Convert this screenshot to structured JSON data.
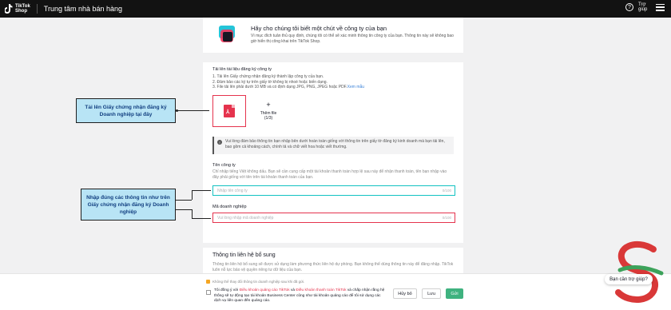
{
  "header": {
    "logo_line1": "TikTok",
    "logo_line2": "Shop",
    "title": "Trung tâm nhà bán hàng",
    "help_label": "Trợ giúp",
    "help_icon": "question-circle-icon",
    "menu_icon": "hamburger-menu-icon"
  },
  "intro": {
    "title": "Hãy cho chúng tôi biết một chút về công ty của bạn",
    "description": "Vì mục đích tuân thủ quy định, chúng tôi có thể sẽ xác minh thông tin công ty của bạn. Thông tin này sẽ không bao giờ hiển thị công khai trên TikTok Shop."
  },
  "upload_section": {
    "title": "Tải lên tài liệu đăng ký công ty",
    "step1": "1. Tải lên Giấy chứng nhận đăng ký thành lập công ty của bạn.",
    "step2": "2. Đảm bảo các ký tự trên giấy tờ không bị nhoè hoặc biến dạng.",
    "step3": "3. File tải lên phải dưới 10 MB và có định dạng JPG, PNG, JPEG hoặc PDF.",
    "example_link": "Xem mẫu",
    "add_file_label": "Thêm file",
    "add_file_count": "(1/3)"
  },
  "notice": "Vui lòng đảm bảo thông tin bạn nhập bên dưới hoàn toàn giống với thông tin trên giấy tờ đăng ký kinh doanh mà bạn tải lên, bao gồm cả khoảng cách, chính tả và chữ viết hoa hoặc viết thường.",
  "company_name": {
    "title": "Tên công ty",
    "help": "Chỉ nhập tiếng Việt không dấu. Bạn sẽ cần cung cấp một tài khoản thanh toán hợp lệ sau này để nhận thanh toán, tên bạn nhập vào đây phải giống với tên trên tài khoản thanh toán của bạn.",
    "placeholder": "Nhập tên công ty",
    "counter": "0/100"
  },
  "business_code": {
    "title": "Mã doanh nghiệp",
    "placeholder": "Vui lòng nhập mã doanh nghiệp",
    "counter": "0/100"
  },
  "extra_contact": {
    "title": "Thông tin liên hệ bổ sung",
    "description": "Thông tin liên hệ bổ sung sẽ được sử dụng làm phương thức liên hệ dự phòng. Bạn không thể dùng thông tin này để đăng nhập. TikTok luôn nỗ lực bảo vệ quyền riêng tư dữ liệu của bạn."
  },
  "footer": {
    "warning": "Không thể thay đổi thông tin doanh nghiệp sau khi đã gửi.",
    "agree_prefix": "Tôi đồng ý với ",
    "agree_link1": "Điều khoản quảng cáo TikTok",
    "agree_mid": " và ",
    "agree_link2": "Điều khoản thanh toán TikTok",
    "agree_suffix": " và chấp nhận rằng hệ thống sẽ tự động tạo tài khoản Business Center cũng như tài khoản quảng cáo để tôi sử dụng các dịch vụ liên quan đến quảng cáo.",
    "cancel": "Hủy bỏ",
    "save": "Lưu",
    "submit": "Gửi"
  },
  "annotations": {
    "callout1": "Tải lên Giấy chứng nhận đăng ký Doanh nghiệp tại đây",
    "callout2": "Nhập đúng các thông tin như trên Giấy chứng nhận đăng ký Doanh nghiệp"
  },
  "help_bubble": "Bạn cần trợ giúp?",
  "colors": {
    "accent_red": "#e5334d",
    "accent_teal": "#13c2c2",
    "submit_green": "#3fb27f",
    "callout_bg": "#b8e4f5"
  }
}
